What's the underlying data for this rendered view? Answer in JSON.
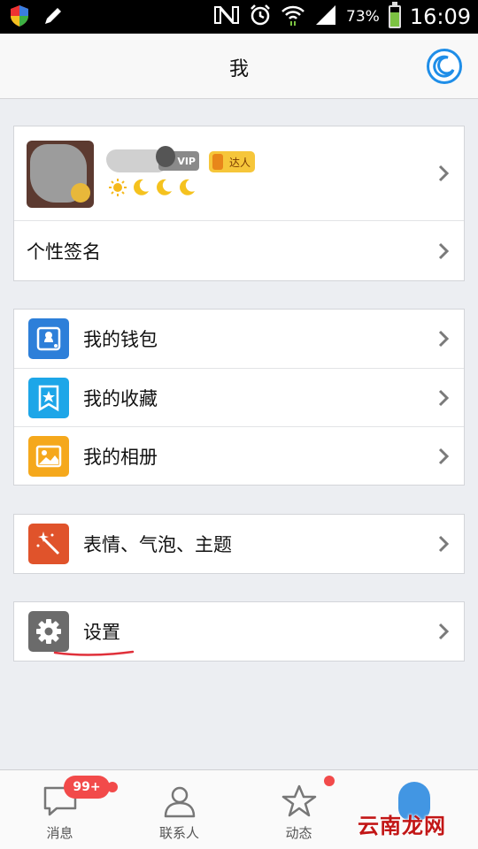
{
  "status_bar": {
    "battery_percent": "73%",
    "battery_level": 0.73,
    "time": "16:09",
    "icons": [
      "shield-icon",
      "pen-icon",
      "nfc-icon",
      "alarm-icon",
      "wifi-icon",
      "signal-icon",
      "battery-icon"
    ]
  },
  "header": {
    "title": "我",
    "right_icon": "moon-icon",
    "accent": "#1f8ee8"
  },
  "profile": {
    "nickname": "",
    "vip_label": "VIP",
    "daren_label": "达人",
    "level_icons": [
      "sun-icon",
      "moon-icon",
      "moon-icon",
      "moon-icon"
    ],
    "signature_label": "个性签名"
  },
  "menu": {
    "group1": [
      {
        "label": "我的钱包",
        "icon": "wallet-icon",
        "color": "#2d7fd9"
      },
      {
        "label": "我的收藏",
        "icon": "favorites-icon",
        "color": "#1da6e8"
      },
      {
        "label": "我的相册",
        "icon": "album-icon",
        "color": "#f5a81c"
      }
    ],
    "group2": [
      {
        "label": "表情、气泡、主题",
        "icon": "magic-wand-icon",
        "color": "#e0532b"
      }
    ],
    "group3": [
      {
        "label": "设置",
        "icon": "gear-icon",
        "color": "#6b6b6b"
      }
    ]
  },
  "bottom_nav": {
    "items": [
      {
        "label": "消息",
        "icon": "message-icon"
      },
      {
        "label": "联系人",
        "icon": "contacts-icon"
      },
      {
        "label": "动态",
        "icon": "star-icon"
      },
      {
        "label": "",
        "icon": "penguin-icon"
      }
    ],
    "message_badge": "99+",
    "badge_color": "#f24a4a"
  },
  "watermark": "云南龙网"
}
